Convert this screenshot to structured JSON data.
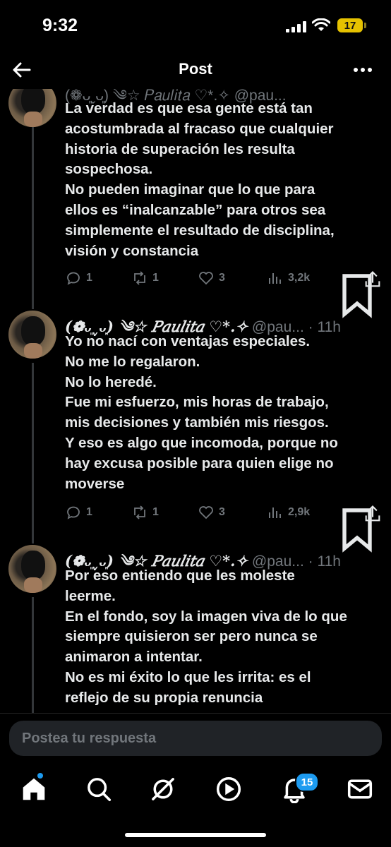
{
  "status_bar": {
    "time": "9:32",
    "battery": "17"
  },
  "header": {
    "title": "Post"
  },
  "tweets": [
    {
      "cut_author": "(❁ᴗ͈ˬᴗ͈) ༄☆ 𝑃𝑎𝑢𝑙𝑖𝑡𝑎 ♡*.✧ @pau...",
      "lines": [
        "La verdad es que esa gente está tan",
        "acostumbrada al fracaso que cualquier",
        "historia de superación les resulta",
        "sospechosa.",
        "No pueden imaginar que lo que para",
        "ellos es “inalcanzable” para otros sea",
        "simplemente el resultado de disciplina,",
        "visión y constancia"
      ],
      "replies": "1",
      "reposts": "1",
      "likes": "3",
      "views": "3,2k"
    },
    {
      "name": "(❁ᴗ͈ˬᴗ͈) ༄☆ 𝑃𝑎𝑢𝑙𝑖𝑡𝑎 ♡*.✧",
      "handle": "@pau...",
      "time": "· 11h",
      "lines": [
        "Yo no nací con ventajas especiales.",
        "No me lo regalaron.",
        "No lo heredé.",
        "Fue mi esfuerzo, mis horas de trabajo,",
        "mis decisiones y también mis riesgos.",
        "Y eso es algo que incomoda, porque no",
        "hay excusa posible para quien elige no",
        "moverse"
      ],
      "replies": "1",
      "reposts": "1",
      "likes": "3",
      "views": "2,9k"
    },
    {
      "name": "(❁ᴗ͈ˬᴗ͈) ༄☆ 𝑃𝑎𝑢𝑙𝑖𝑡𝑎 ♡*.✧",
      "handle": "@pau...",
      "time": "· 11h",
      "lines": [
        "Por eso entiendo que les moleste",
        "leerme.",
        "En el fondo, soy la imagen viva de lo que",
        "siempre quisieron ser pero nunca se",
        "animaron a intentar.",
        "No es mi éxito lo que les irrita: es el",
        "reflejo de su propia renuncia"
      ]
    }
  ],
  "reply": {
    "placeholder": "Postea tu respuesta"
  },
  "tabbar": {
    "notifications_badge": "15"
  },
  "colors": {
    "accent": "#1d9bf0",
    "muted": "#71767b",
    "text": "#e7e9ea",
    "background": "#000000"
  }
}
